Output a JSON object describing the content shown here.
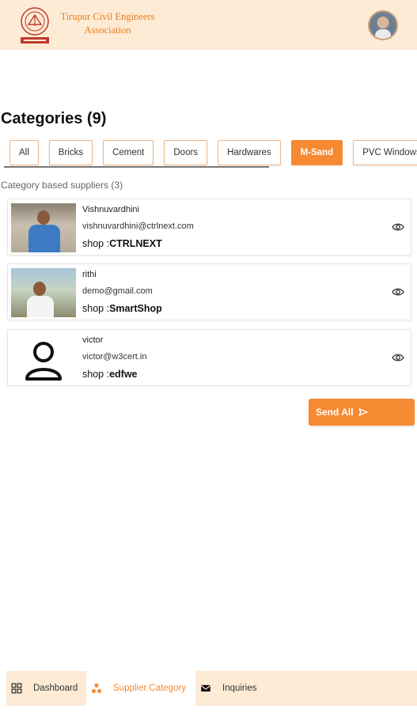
{
  "header": {
    "brand_line1": "Tirupur Civil Engineers",
    "brand_line2": "Association",
    "logo_icon": "tcea-logo-icon",
    "avatar_icon": "user-avatar"
  },
  "page_title": "Categories (9)",
  "tabs": [
    {
      "label": "All",
      "active": false
    },
    {
      "label": "Bricks",
      "active": false
    },
    {
      "label": "Cement",
      "active": false
    },
    {
      "label": "Doors",
      "active": false
    },
    {
      "label": "Hardwares",
      "active": false
    },
    {
      "label": "M-Sand",
      "active": true
    },
    {
      "label": "PVC Windows",
      "active": false
    }
  ],
  "subtitle": "Category based suppliers (3)",
  "suppliers": [
    {
      "name": "Vishnuvardhini",
      "email": "vishnuvardhini@ctrlnext.com",
      "shop_prefix": "shop :",
      "shop": "CTRLNEXT",
      "photo": "photo"
    },
    {
      "name": "rithi",
      "email": "demo@gmail.com",
      "shop_prefix": "shop :",
      "shop": "SmartShop",
      "photo": "photo"
    },
    {
      "name": "victor",
      "email": "victor@w3cert.in",
      "shop_prefix": "shop :",
      "shop": "edfwe",
      "photo": "person-placeholder-icon"
    }
  ],
  "send_all": {
    "label": "Send All",
    "icon": "send-icon"
  },
  "bottom_nav": [
    {
      "label": "Dashboard",
      "icon": "grid-icon",
      "active": false
    },
    {
      "label": "Supplier Category",
      "icon": "category-icon",
      "active": true
    },
    {
      "label": "Inquiries",
      "icon": "mail-icon",
      "active": false
    }
  ],
  "colors": {
    "accent": "#f58a33",
    "header_bg": "#fdebd6",
    "brand_text": "#e67e22"
  }
}
